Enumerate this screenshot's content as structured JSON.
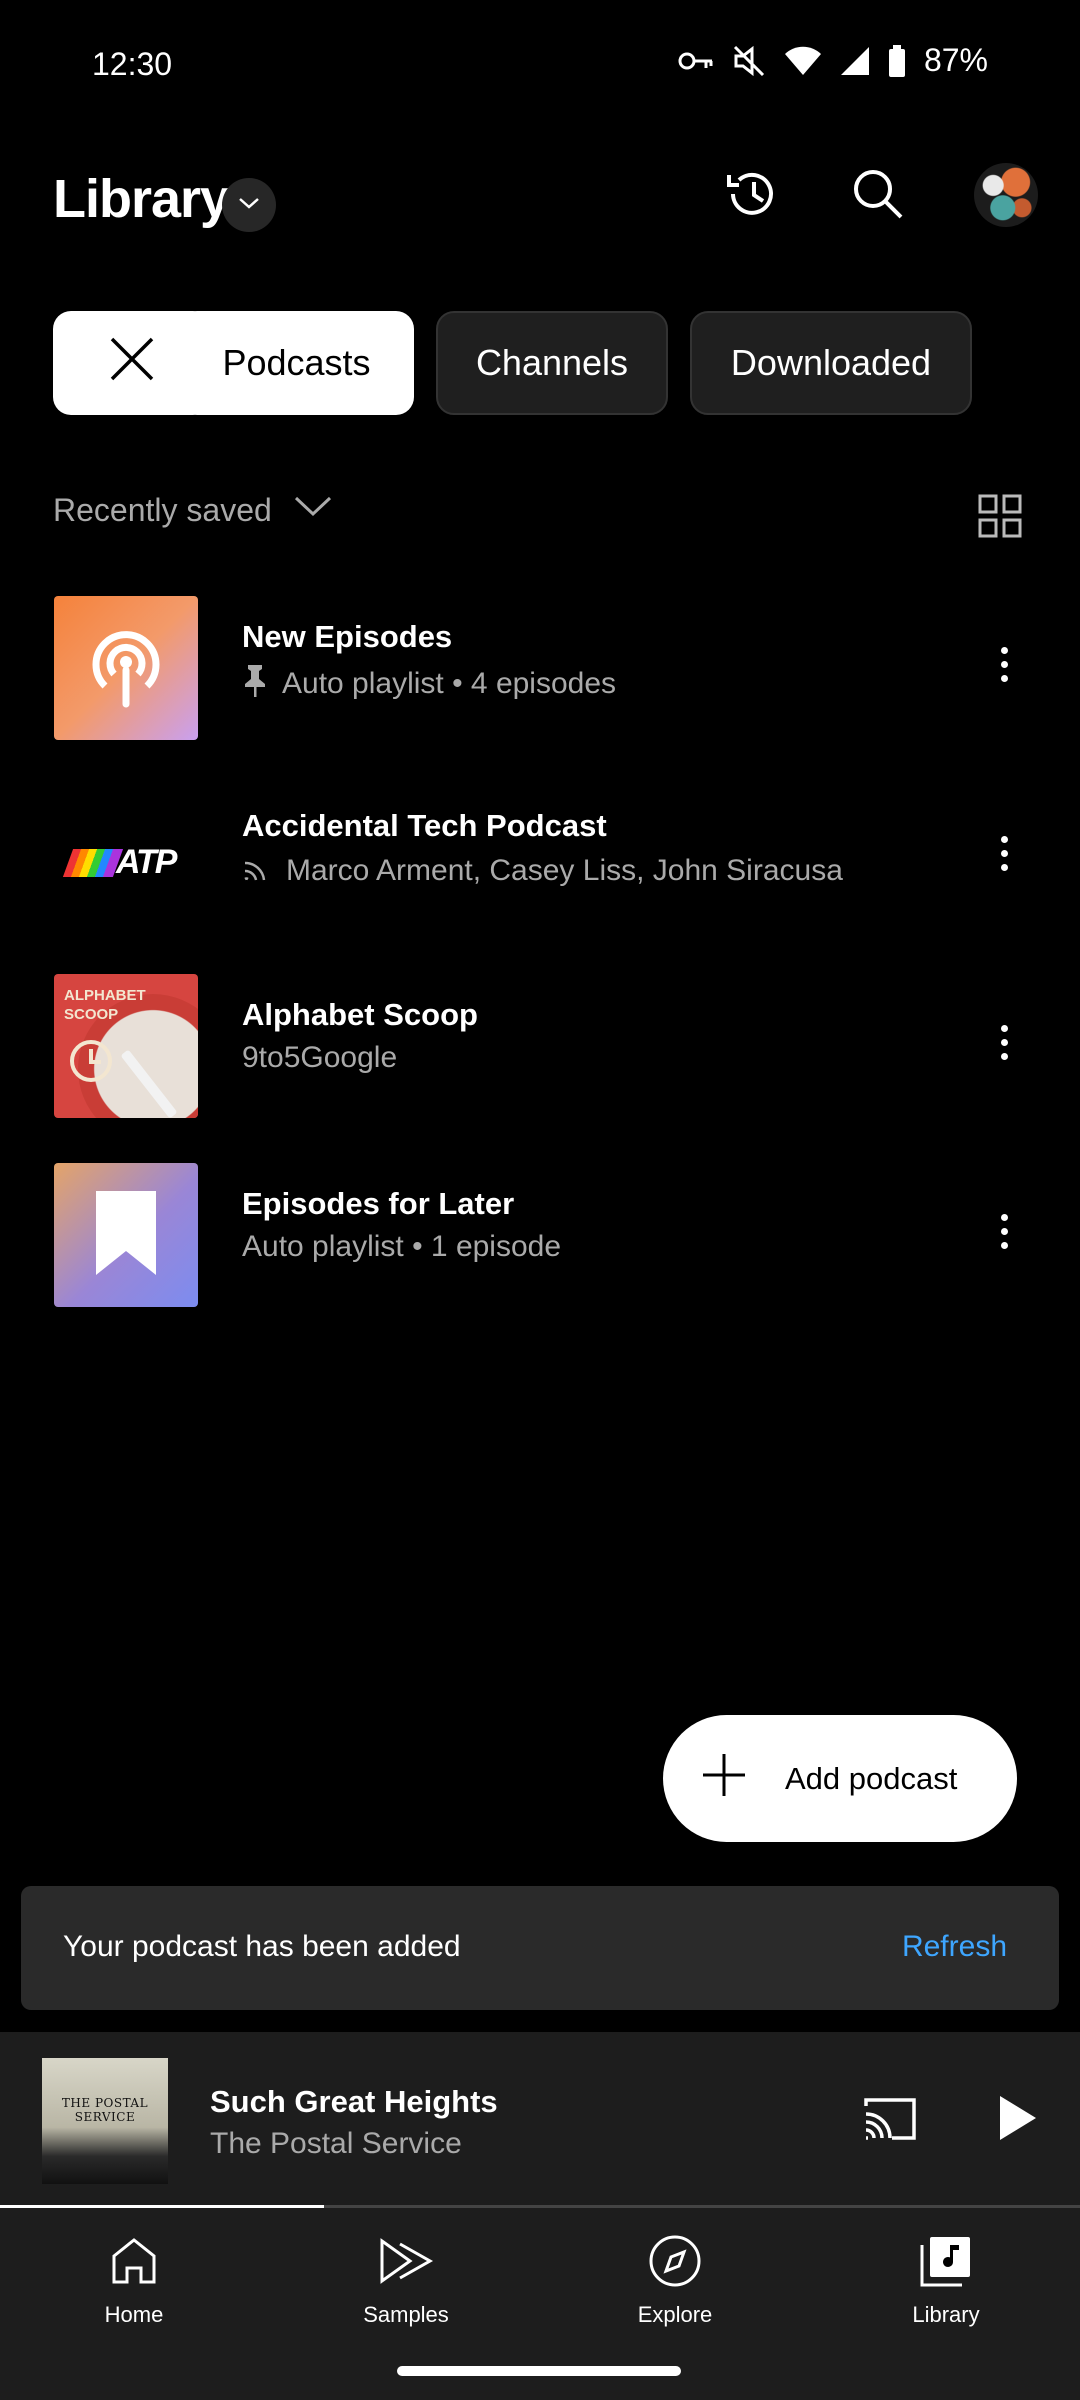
{
  "status_bar": {
    "time": "12:30",
    "battery": "87%"
  },
  "header": {
    "title": "Library",
    "icons": [
      "history-icon",
      "search-icon",
      "account-avatar"
    ]
  },
  "chips": [
    {
      "label": "",
      "icon": "close-icon",
      "selected": true
    },
    {
      "label": "Podcasts",
      "selected": true
    },
    {
      "label": "Channels",
      "selected": false
    },
    {
      "label": "Downloaded",
      "selected": false
    }
  ],
  "sort": {
    "label": "Recently saved"
  },
  "items": [
    {
      "title": "New Episodes",
      "subtitle": "Auto playlist • 4 episodes",
      "sub_icon": "pin-icon"
    },
    {
      "title": "Accidental Tech Podcast",
      "subtitle": "Marco Arment, Casey Liss, John Siracusa",
      "sub_icon": "rss-icon",
      "thumb_text": "ATP"
    },
    {
      "title": "Alphabet Scoop",
      "subtitle": "9to5Google",
      "thumb_text": "ALPHABET SCOOP"
    },
    {
      "title": "Episodes for Later",
      "subtitle": "Auto playlist • 1 episode"
    }
  ],
  "fab": {
    "label": "Add podcast"
  },
  "snackbar": {
    "message": "Your podcast has been added",
    "action": "Refresh"
  },
  "now_playing": {
    "title": "Such Great Heights",
    "artist": "The Postal Service",
    "art_text": "THE POSTAL SERVICE",
    "progress": 0.3
  },
  "nav": [
    {
      "label": "Home",
      "icon": "home-icon"
    },
    {
      "label": "Samples",
      "icon": "samples-icon"
    },
    {
      "label": "Explore",
      "icon": "explore-icon"
    },
    {
      "label": "Library",
      "icon": "library-icon",
      "active": true
    }
  ],
  "colors": {
    "accent": "#3ea6ff",
    "background": "#000000",
    "surface": "#1d1d1d"
  }
}
